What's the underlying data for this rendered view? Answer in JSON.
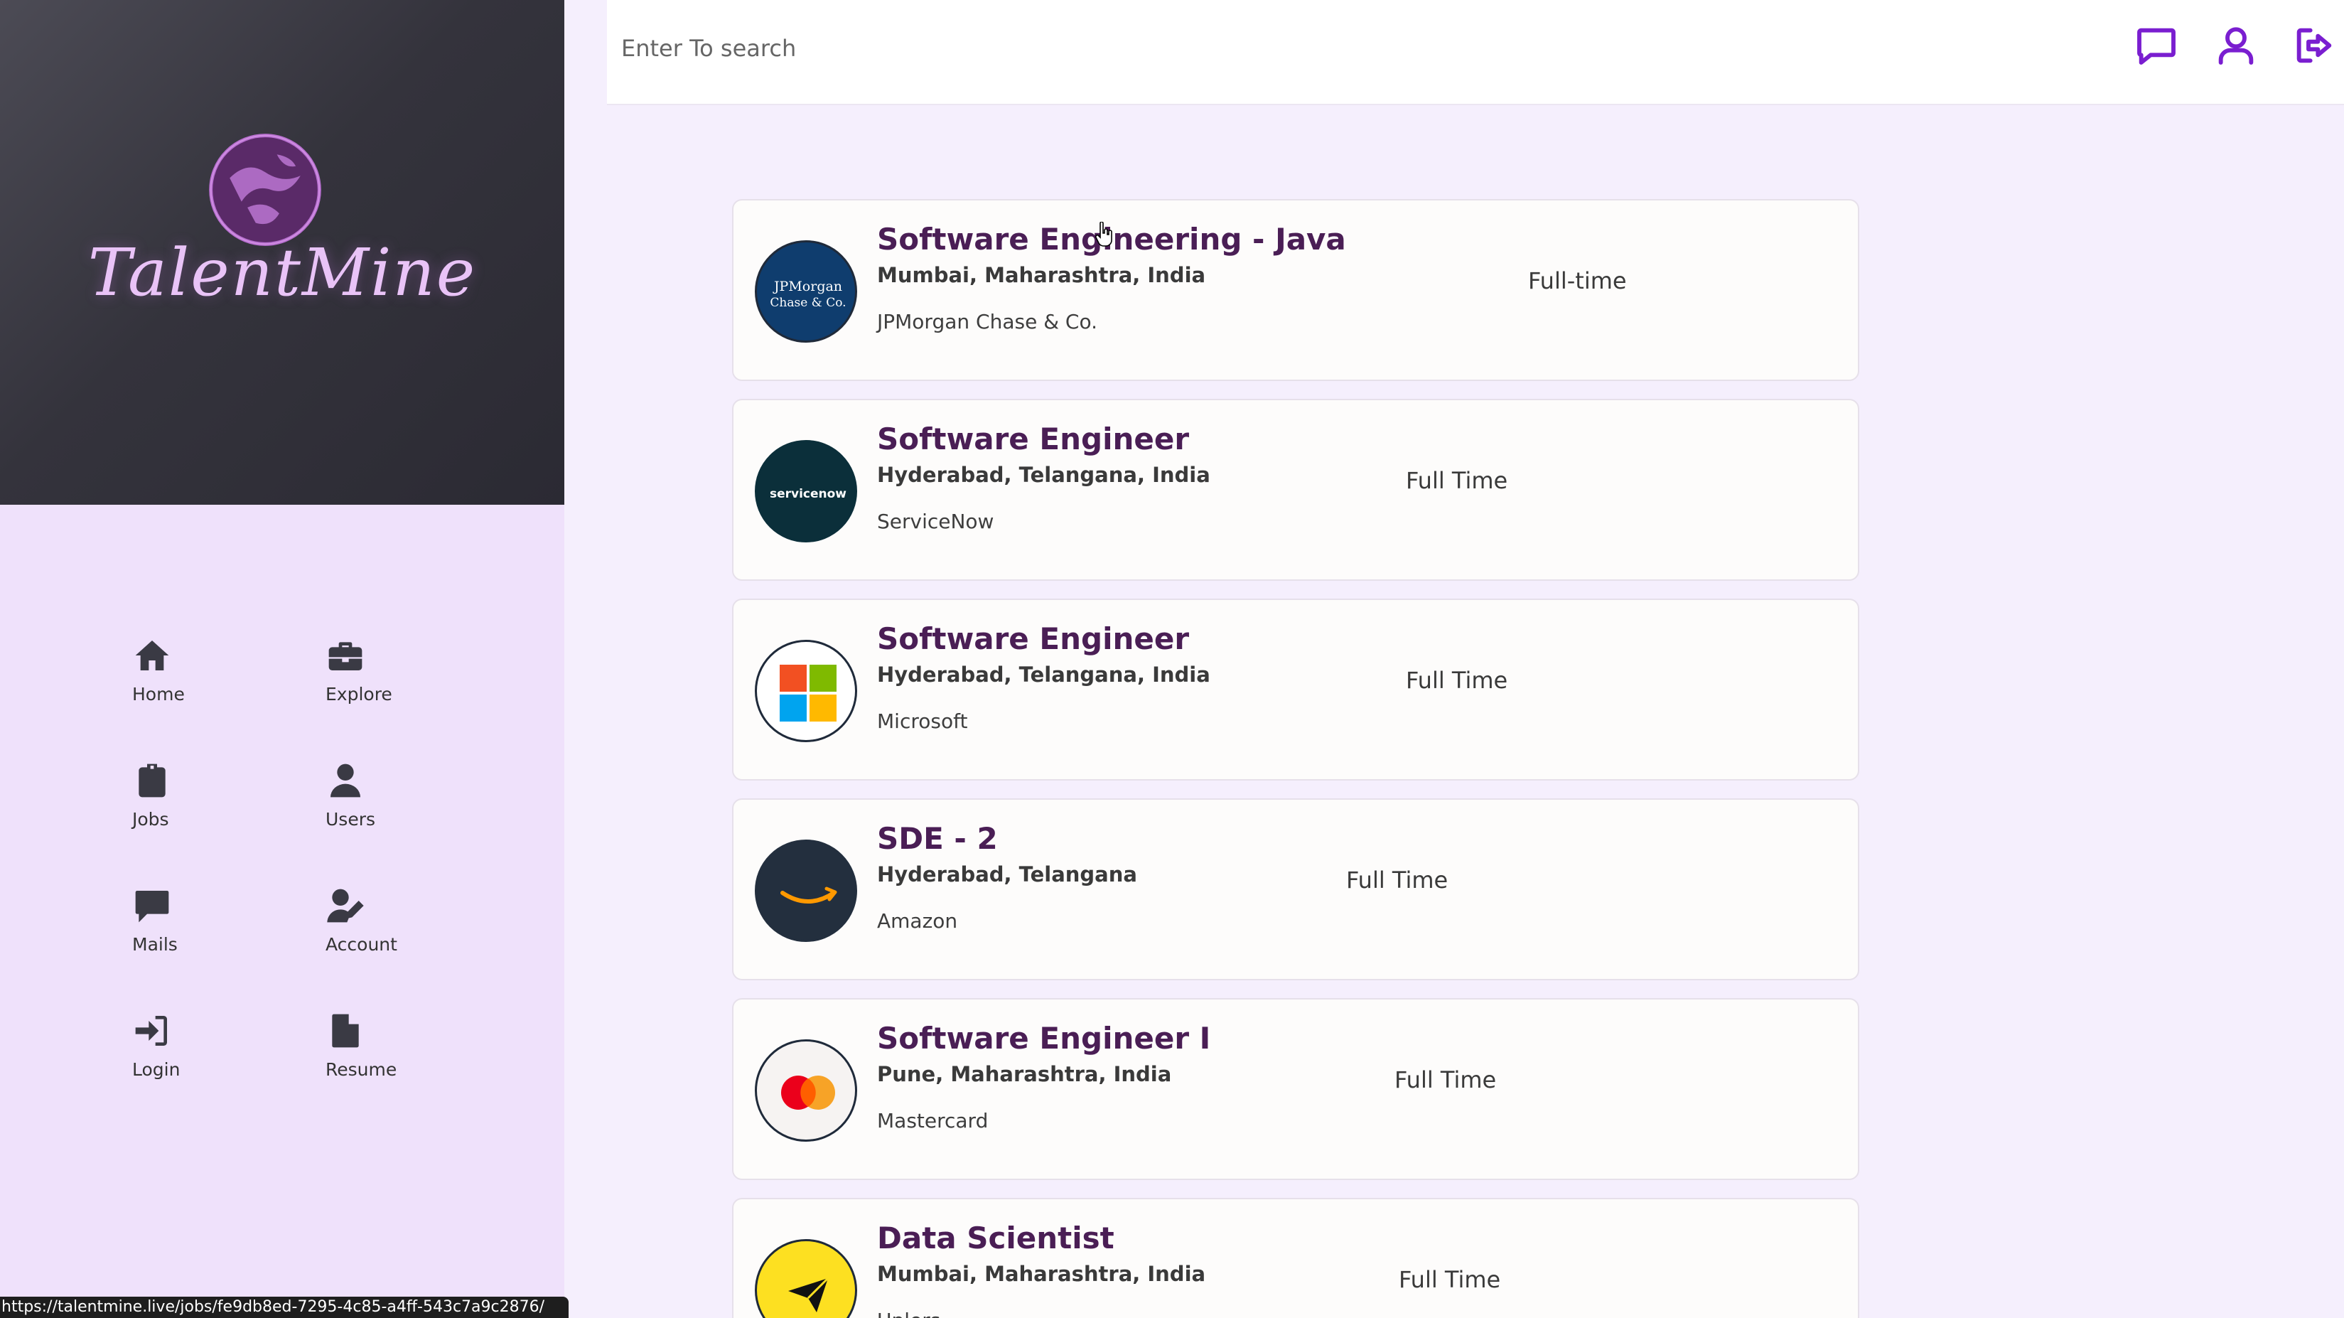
{
  "brand": {
    "name": "TalentMine"
  },
  "sidebar": {
    "items": [
      {
        "label": "Home",
        "icon": "home-icon"
      },
      {
        "label": "Explore",
        "icon": "briefcase-icon"
      },
      {
        "label": "Jobs",
        "icon": "clipboard-icon"
      },
      {
        "label": "Users",
        "icon": "user-icon"
      },
      {
        "label": "Mails",
        "icon": "message-icon"
      },
      {
        "label": "Account",
        "icon": "user-edit-icon"
      },
      {
        "label": "Login",
        "icon": "login-icon"
      },
      {
        "label": "Resume",
        "icon": "file-icon"
      }
    ]
  },
  "header": {
    "search_placeholder": "Enter To search",
    "icons": [
      "message-icon",
      "profile-icon",
      "logout-icon"
    ],
    "accent": "#7a1ed0"
  },
  "jobs": [
    {
      "title": "Software Engineering - Java",
      "location": "Mumbai, Maharashtra, India",
      "company": "JPMorgan Chase & Co.",
      "type": "Full-time",
      "logo": "jpmorgan-logo"
    },
    {
      "title": "Software Engineer",
      "location": "Hyderabad, Telangana, India",
      "company": "ServiceNow",
      "type": "Full Time",
      "logo": "servicenow-logo"
    },
    {
      "title": "Software Engineer",
      "location": "Hyderabad, Telangana, India",
      "company": "Microsoft",
      "type": "Full Time",
      "logo": "microsoft-logo"
    },
    {
      "title": "SDE - 2",
      "location": "Hyderabad, Telangana",
      "company": "Amazon",
      "type": "Full Time",
      "logo": "amazon-logo"
    },
    {
      "title": "Software Engineer I",
      "location": "Pune, Maharashtra, India",
      "company": "Mastercard",
      "type": "Full Time",
      "logo": "mastercard-logo"
    },
    {
      "title": "Data Scientist",
      "location": "Mumbai, Maharashtra, India",
      "company": "Uplers",
      "type": "Full Time",
      "logo": "uplers-logo"
    }
  ],
  "logo_text": {
    "jpmorgan": "JPMorgan Chase & Co.",
    "servicenow": "servicenow"
  },
  "status_url": "https://talentmine.live/jobs/fe9db8ed-7295-4c85-a4ff-543c7a9c2876/"
}
